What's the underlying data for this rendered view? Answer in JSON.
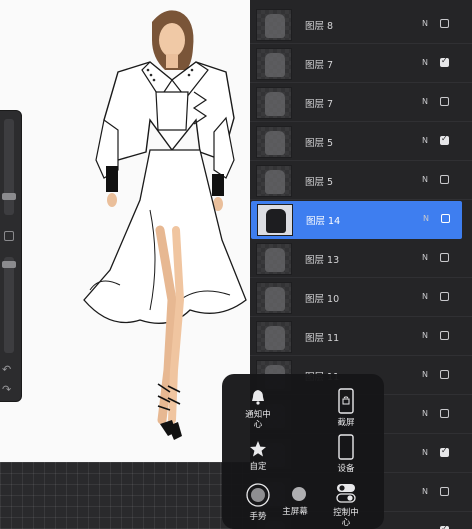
{
  "layers": [
    {
      "name": "图层 8",
      "blend": "N",
      "visible": false,
      "selected": false
    },
    {
      "name": "图层 7",
      "blend": "N",
      "visible": true,
      "selected": false
    },
    {
      "name": "图层 7",
      "blend": "N",
      "visible": false,
      "selected": false
    },
    {
      "name": "图层 5",
      "blend": "N",
      "visible": true,
      "selected": false
    },
    {
      "name": "图层 5",
      "blend": "N",
      "visible": false,
      "selected": false
    },
    {
      "name": "图层 14",
      "blend": "N",
      "visible": false,
      "selected": true
    },
    {
      "name": "图层 13",
      "blend": "N",
      "visible": false,
      "selected": false
    },
    {
      "name": "图层 10",
      "blend": "N",
      "visible": false,
      "selected": false
    },
    {
      "name": "图层 11",
      "blend": "N",
      "visible": false,
      "selected": false
    },
    {
      "name": "图层 11",
      "blend": "N",
      "visible": false,
      "selected": false
    },
    {
      "name": "",
      "blend": "N",
      "visible": false,
      "selected": false
    },
    {
      "name": "",
      "blend": "N",
      "visible": true,
      "selected": false
    },
    {
      "name": "",
      "blend": "N",
      "visible": false,
      "selected": false
    },
    {
      "name": "",
      "blend": "N",
      "visible": true,
      "selected": false
    }
  ],
  "control_center": {
    "notification": "通知中心",
    "screenshot": "截屏",
    "custom": "自定",
    "device": "设备",
    "gesture": "手势",
    "home": "主屏幕",
    "control": "控制中心"
  },
  "tools": {
    "undo_icon": "↶",
    "redo_icon": "↷"
  }
}
